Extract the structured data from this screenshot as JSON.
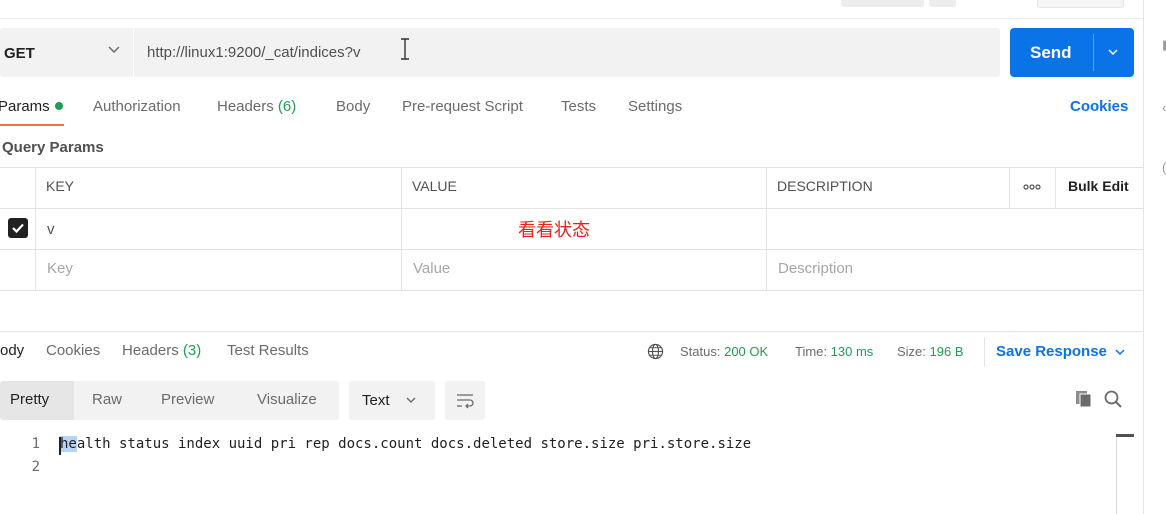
{
  "request": {
    "method": "GET",
    "url": "http://linux1:9200/_cat/indices?v",
    "send_label": "Send"
  },
  "request_tabs": [
    {
      "label": "Params",
      "active": true
    },
    {
      "label": "Authorization"
    },
    {
      "label": "Headers",
      "count": "(6)"
    },
    {
      "label": "Body"
    },
    {
      "label": "Pre-request Script"
    },
    {
      "label": "Tests"
    },
    {
      "label": "Settings"
    }
  ],
  "cookies_link": "Cookies",
  "query_params": {
    "title": "Query Params",
    "columns": [
      "KEY",
      "VALUE",
      "DESCRIPTION"
    ],
    "bulk_edit": "Bulk Edit",
    "rows": [
      {
        "checked": true,
        "key": "v",
        "value": "",
        "description": ""
      }
    ],
    "placeholders": {
      "key": "Key",
      "value": "Value",
      "description": "Description"
    }
  },
  "annotation": "看看状态",
  "response": {
    "tabs": [
      {
        "label": "ody",
        "active": true
      },
      {
        "label": "Cookies"
      },
      {
        "label": "Headers",
        "count": "(3)"
      },
      {
        "label": "Test Results"
      }
    ],
    "status_label": "Status:",
    "status_value": "200 OK",
    "time_label": "Time:",
    "time_value": "130 ms",
    "size_label": "Size:",
    "size_value": "196 B",
    "save_label": "Save Response",
    "view_modes": [
      "Pretty",
      "Raw",
      "Preview",
      "Visualize"
    ],
    "active_view": "Pretty",
    "format": "Text",
    "lines": [
      {
        "num": "1",
        "text_selected": "he",
        "text_rest": "alth status index uuid pri rep docs.count docs.deleted store.size pri.store.size"
      },
      {
        "num": "2",
        "text_selected": "",
        "text_rest": ""
      }
    ]
  },
  "colors": {
    "accent_blue": "#0b73e8",
    "tab_underline": "#ff6c37",
    "status_green": "#1f9d55",
    "annotation_red": "#e0241b"
  },
  "icons": [
    "chevron-down-icon",
    "text-cursor-icon",
    "ellipsis-icon",
    "globe-icon",
    "wrap-lines-icon",
    "copy-icon",
    "search-icon"
  ]
}
